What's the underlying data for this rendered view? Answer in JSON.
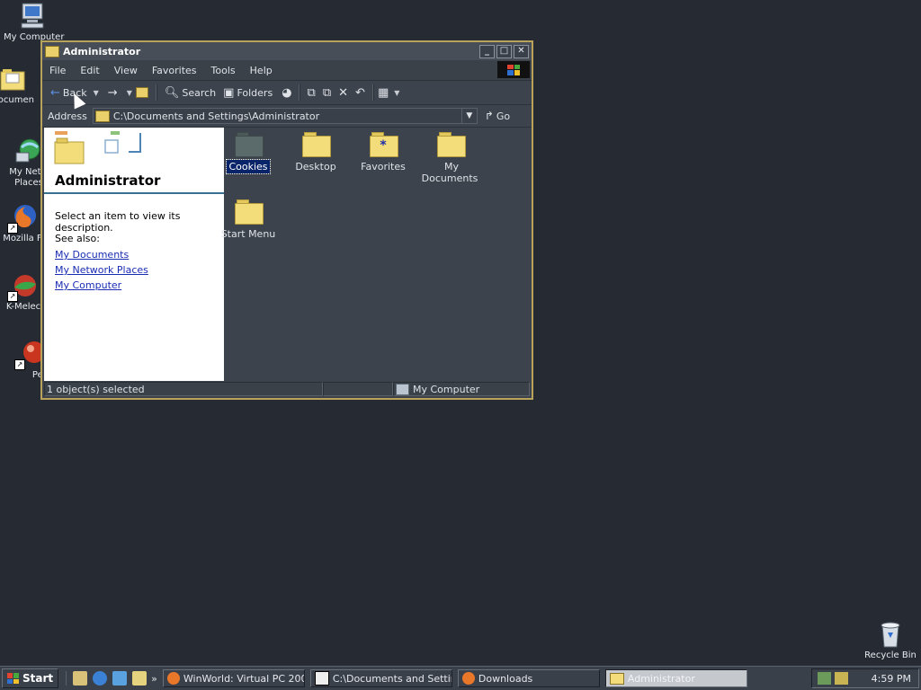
{
  "desktop": {
    "icons": [
      {
        "label": "My Computer"
      },
      {
        "label": "Documen"
      },
      {
        "label": "My Netw"
      },
      {
        "label": "Places"
      },
      {
        "label": "Mozilla Fi"
      },
      {
        "label": "K-Melec"
      },
      {
        "label": "Peg"
      },
      {
        "label": "Recycle Bin"
      }
    ]
  },
  "window": {
    "title": "Administrator",
    "menu": [
      "File",
      "Edit",
      "View",
      "Favorites",
      "Tools",
      "Help"
    ],
    "toolbar": {
      "back_label": "Back",
      "search_label": "Search",
      "folders_label": "Folders"
    },
    "address": {
      "label": "Address",
      "path": "C:\\Documents and Settings\\Administrator",
      "go_label": "Go"
    },
    "left_pane": {
      "title": "Administrator",
      "description": "Select an item to view its description.",
      "see_also": "See also:",
      "links": [
        "My Documents",
        "My Network Places",
        "My Computer"
      ]
    },
    "items": [
      {
        "label": "Cookies",
        "selected": true
      },
      {
        "label": "Desktop"
      },
      {
        "label": "Favorites"
      },
      {
        "label": "My Documents"
      },
      {
        "label": "Start Menu"
      }
    ],
    "status": {
      "selection": "1 object(s) selected",
      "zone": "My Computer"
    }
  },
  "taskbar": {
    "start_label": "Start",
    "tasks": [
      {
        "label": "WinWorld: Virtual PC 200..."
      },
      {
        "label": "C:\\Documents and Settin..."
      },
      {
        "label": "Downloads"
      },
      {
        "label": "Administrator"
      }
    ],
    "clock": "4:59 PM"
  },
  "colors": {
    "desktop_bg": "#252a33",
    "window_border": "#b9a25a",
    "selection": "#0a246a",
    "link": "#1a2cb3"
  }
}
